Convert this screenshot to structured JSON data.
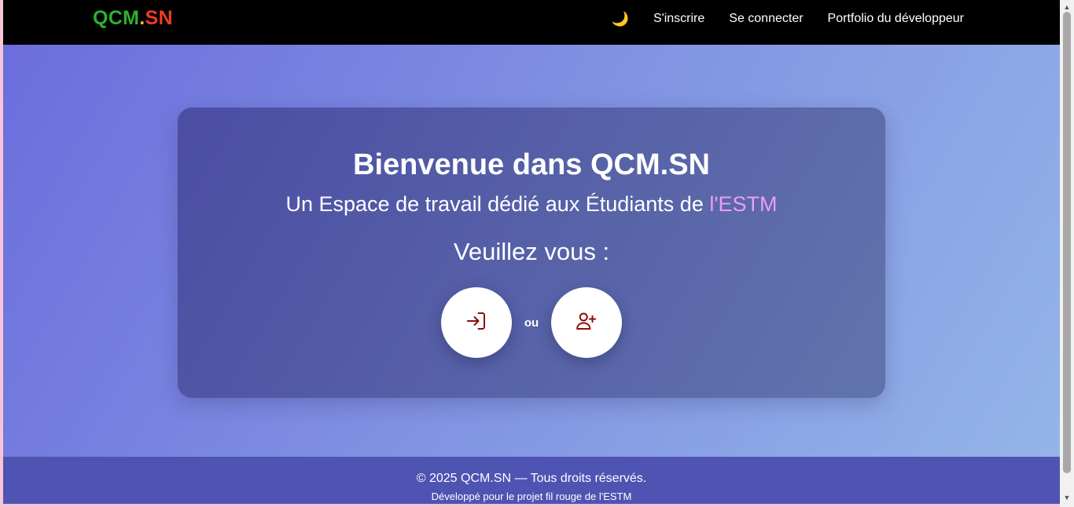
{
  "navbar": {
    "brand_part1": "QCM",
    "brand_dot": ".",
    "brand_part2": "SN",
    "theme_toggle_icon": "🌙",
    "links": [
      "S'inscrire",
      "Se connecter",
      "Portfolio du développeur"
    ]
  },
  "hero": {
    "title": "Bienvenue dans QCM.SN",
    "subtitle_prefix": "Un Espace de travail dédié aux Étudiants de ",
    "subtitle_accent": "l'ESTM",
    "prompt": "Veuillez vous :",
    "separator": "ou",
    "login_icon": "login-icon",
    "register_icon": "user-plus-icon"
  },
  "footer": {
    "copyright": "© 2025 QCM.SN — Tous droits réservés.",
    "developed": "Développé pour le projet fil rouge de l'ESTM"
  },
  "colors": {
    "brand_green": "#2db12f",
    "brand_yellow": "#f4c21a",
    "brand_red": "#ef3b24",
    "accent_pink": "#ee9cf4",
    "icon_dark_red": "#8b0e0e",
    "footer_bg": "#4f53b2"
  }
}
